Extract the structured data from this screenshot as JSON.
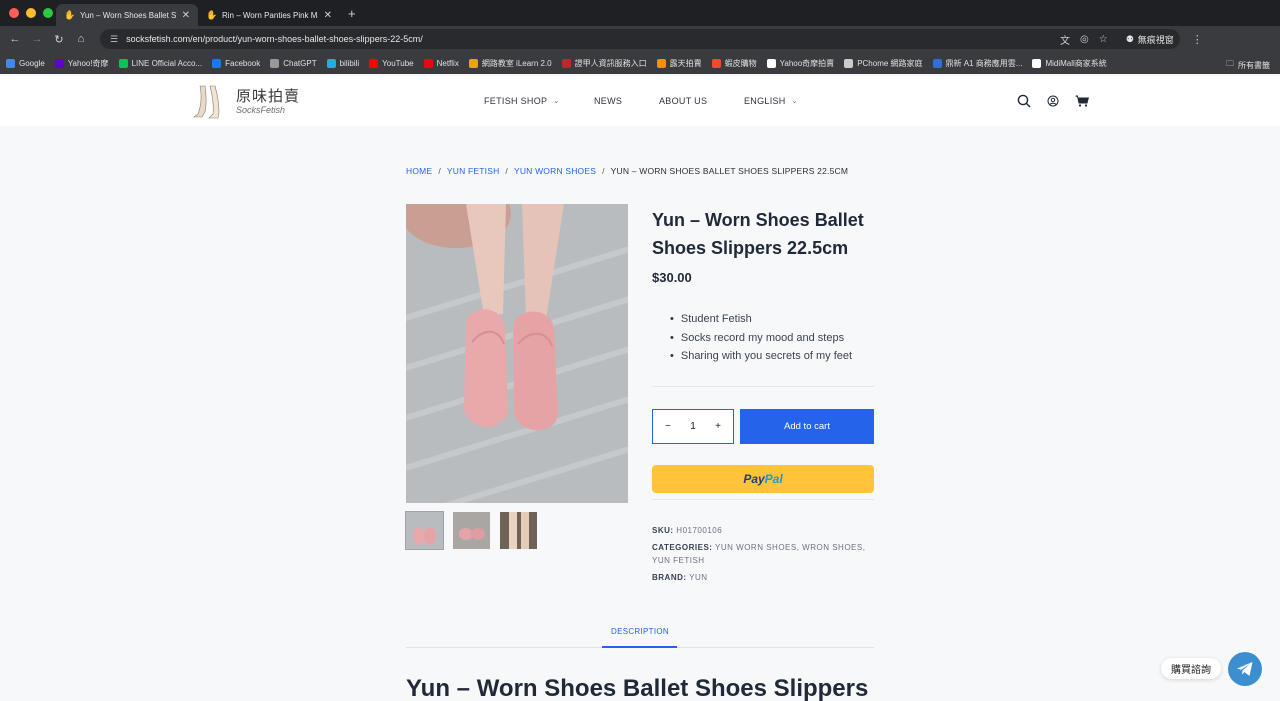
{
  "browser": {
    "tabs": [
      {
        "title": "Yun – Worn Shoes Ballet Sho",
        "active": true
      },
      {
        "title": "Rin – Worn Panties Pink Maid",
        "active": false
      }
    ],
    "url": "socksfetish.com/en/product/yun-worn-shoes-ballet-shoes-slippers-22-5cm/",
    "incognito_label": "無痕視窗",
    "bookmarks": [
      {
        "label": "Google",
        "icon": "google-icon",
        "color": "#4285f4"
      },
      {
        "label": "Yahoo!奇摩",
        "icon": "yahoo-icon",
        "color": "#6001d2"
      },
      {
        "label": "LINE Official Acco...",
        "icon": "line-icon",
        "color": "#06c755"
      },
      {
        "label": "Facebook",
        "icon": "facebook-icon",
        "color": "#1877f2"
      },
      {
        "label": "ChatGPT",
        "icon": "chatgpt-icon",
        "color": "#999999"
      },
      {
        "label": "bilibili",
        "icon": "bilibili-icon",
        "color": "#23ade5"
      },
      {
        "label": "YouTube",
        "icon": "youtube-icon",
        "color": "#ff0000"
      },
      {
        "label": "Netflix",
        "icon": "netflix-icon",
        "color": "#e50914"
      },
      {
        "label": "網路教室 iLearn 2.0",
        "icon": "ilearn-icon",
        "color": "#e8a317"
      },
      {
        "label": "證甲人資訊服務入口",
        "icon": "portal-icon",
        "color": "#c0262d"
      },
      {
        "label": "露天拍賣",
        "icon": "ruten-icon",
        "color": "#ff8c00"
      },
      {
        "label": "蝦皮購物",
        "icon": "shopee-icon",
        "color": "#ee4d2d"
      },
      {
        "label": "Yahoo奇摩拍賣",
        "icon": "yahoo-auction-icon",
        "color": "#ffffff"
      },
      {
        "label": "PChome 網路家庭",
        "icon": "pchome-icon",
        "color": "#cccccc"
      },
      {
        "label": "鼎新 A1 商務應用雲...",
        "icon": "dingxin-icon",
        "color": "#2f6fd6"
      },
      {
        "label": "MidiMall商家系統",
        "icon": "midimall-icon",
        "color": "#ffffff"
      }
    ],
    "all_bookmarks": "所有書籤"
  },
  "header": {
    "logo_cn": "原味拍賣",
    "logo_en": "SocksFetish",
    "nav": [
      {
        "label": "FETISH SHOP",
        "dropdown": true
      },
      {
        "label": "NEWS",
        "dropdown": false
      },
      {
        "label": "ABOUT US",
        "dropdown": false
      },
      {
        "label": "ENGLISH",
        "dropdown": true
      }
    ]
  },
  "breadcrumb": {
    "home": "HOME",
    "cat1": "YUN FETISH",
    "cat2": "YUN WORN SHOES",
    "current": "YUN – WORN SHOES BALLET SHOES SLIPPERS 22.5CM"
  },
  "product": {
    "title": "Yun – Worn Shoes Ballet Shoes Slippers 22.5cm",
    "price": "$30.00",
    "features": [
      "Student Fetish",
      "Socks record my mood and steps",
      "Sharing with you secrets of my feet"
    ],
    "quantity": "1",
    "add_to_cart": "Add to cart",
    "paypal_a": "Pay",
    "paypal_b": "Pal",
    "sku_label": "SKU:",
    "sku": "H01700106",
    "categories_label": "CATEGORIES:",
    "categories": [
      "YUN WORN SHOES",
      "WRON SHOES",
      "YUN FETISH"
    ],
    "brand_label": "BRAND:",
    "brand": "YUN"
  },
  "tabs": {
    "description": "DESCRIPTION"
  },
  "description_title": "Yun – Worn Shoes Ballet Shoes Slippers",
  "chat": {
    "label": "購買諮詢"
  },
  "colors": {
    "accent": "#2563eb",
    "paypal": "#ffc439",
    "telegram": "#3b8fd1"
  }
}
